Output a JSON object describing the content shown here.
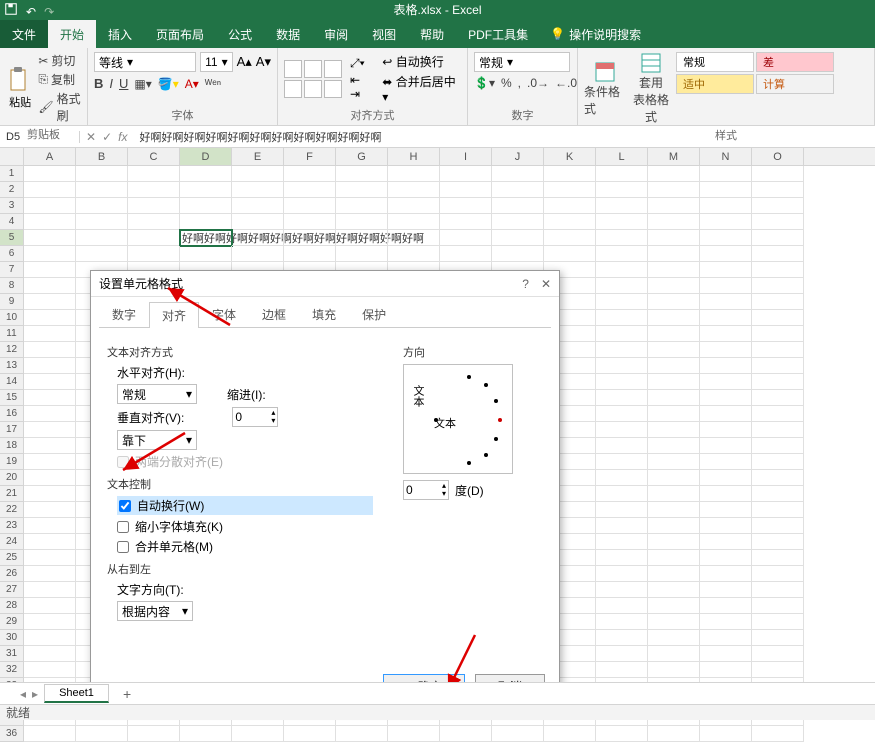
{
  "app": {
    "title": "表格.xlsx - Excel"
  },
  "menu": {
    "file": "文件",
    "home": "开始",
    "insert": "插入",
    "layout": "页面布局",
    "formula": "公式",
    "data": "数据",
    "review": "审阅",
    "view": "视图",
    "help": "帮助",
    "pdf": "PDF工具集",
    "tell_me": "操作说明搜索"
  },
  "ribbon": {
    "clipboard": {
      "paste": "粘贴",
      "cut": "剪切",
      "copy": "复制",
      "format_painter": "格式刷",
      "label": "剪贴板"
    },
    "font": {
      "name": "等线",
      "size": "11",
      "label": "字体"
    },
    "align": {
      "wrap": "自动换行",
      "merge": "合并后居中",
      "label": "对齐方式"
    },
    "number": {
      "format": "常规",
      "label": "数字"
    },
    "styles": {
      "cond": "条件格式",
      "table": "套用\n表格格式",
      "normal": "常规",
      "bad": "差",
      "good": "适中",
      "calc": "计算",
      "label": "样式"
    }
  },
  "formula_bar": {
    "name_box": "D5",
    "value": "好啊好啊好啊好啊好啊好啊好啊好啊好啊好啊好啊"
  },
  "columns": [
    "A",
    "B",
    "C",
    "D",
    "E",
    "F",
    "G",
    "H",
    "I",
    "J",
    "K",
    "L",
    "M",
    "N",
    "O"
  ],
  "cell_content": "好啊好啊好啊好啊好啊好啊好啊好啊好啊好啊好啊",
  "dialog": {
    "title": "设置单元格格式",
    "tabs": {
      "number": "数字",
      "align": "对齐",
      "font": "字体",
      "border": "边框",
      "fill": "填充",
      "protect": "保护"
    },
    "text_align_section": "文本对齐方式",
    "h_align_label": "水平对齐(H):",
    "h_align_value": "常规",
    "indent_label": "缩进(I):",
    "indent_value": "0",
    "v_align_label": "垂直对齐(V):",
    "v_align_value": "靠下",
    "justify_dist": "两端分散对齐(E)",
    "text_control_section": "文本控制",
    "wrap": "自动换行(W)",
    "shrink": "缩小字体填充(K)",
    "merge": "合并单元格(M)",
    "rtl_section": "从右到左",
    "text_dir_label": "文字方向(T):",
    "text_dir_value": "根据内容",
    "orientation_label": "方向",
    "orient_text_v": "文本",
    "orient_text_h": "文本",
    "degree_value": "0",
    "degree_label": "度(D)",
    "ok": "确定",
    "cancel": "取消"
  },
  "sheet": {
    "tab1": "Sheet1",
    "add": "+"
  },
  "status": "就绪"
}
